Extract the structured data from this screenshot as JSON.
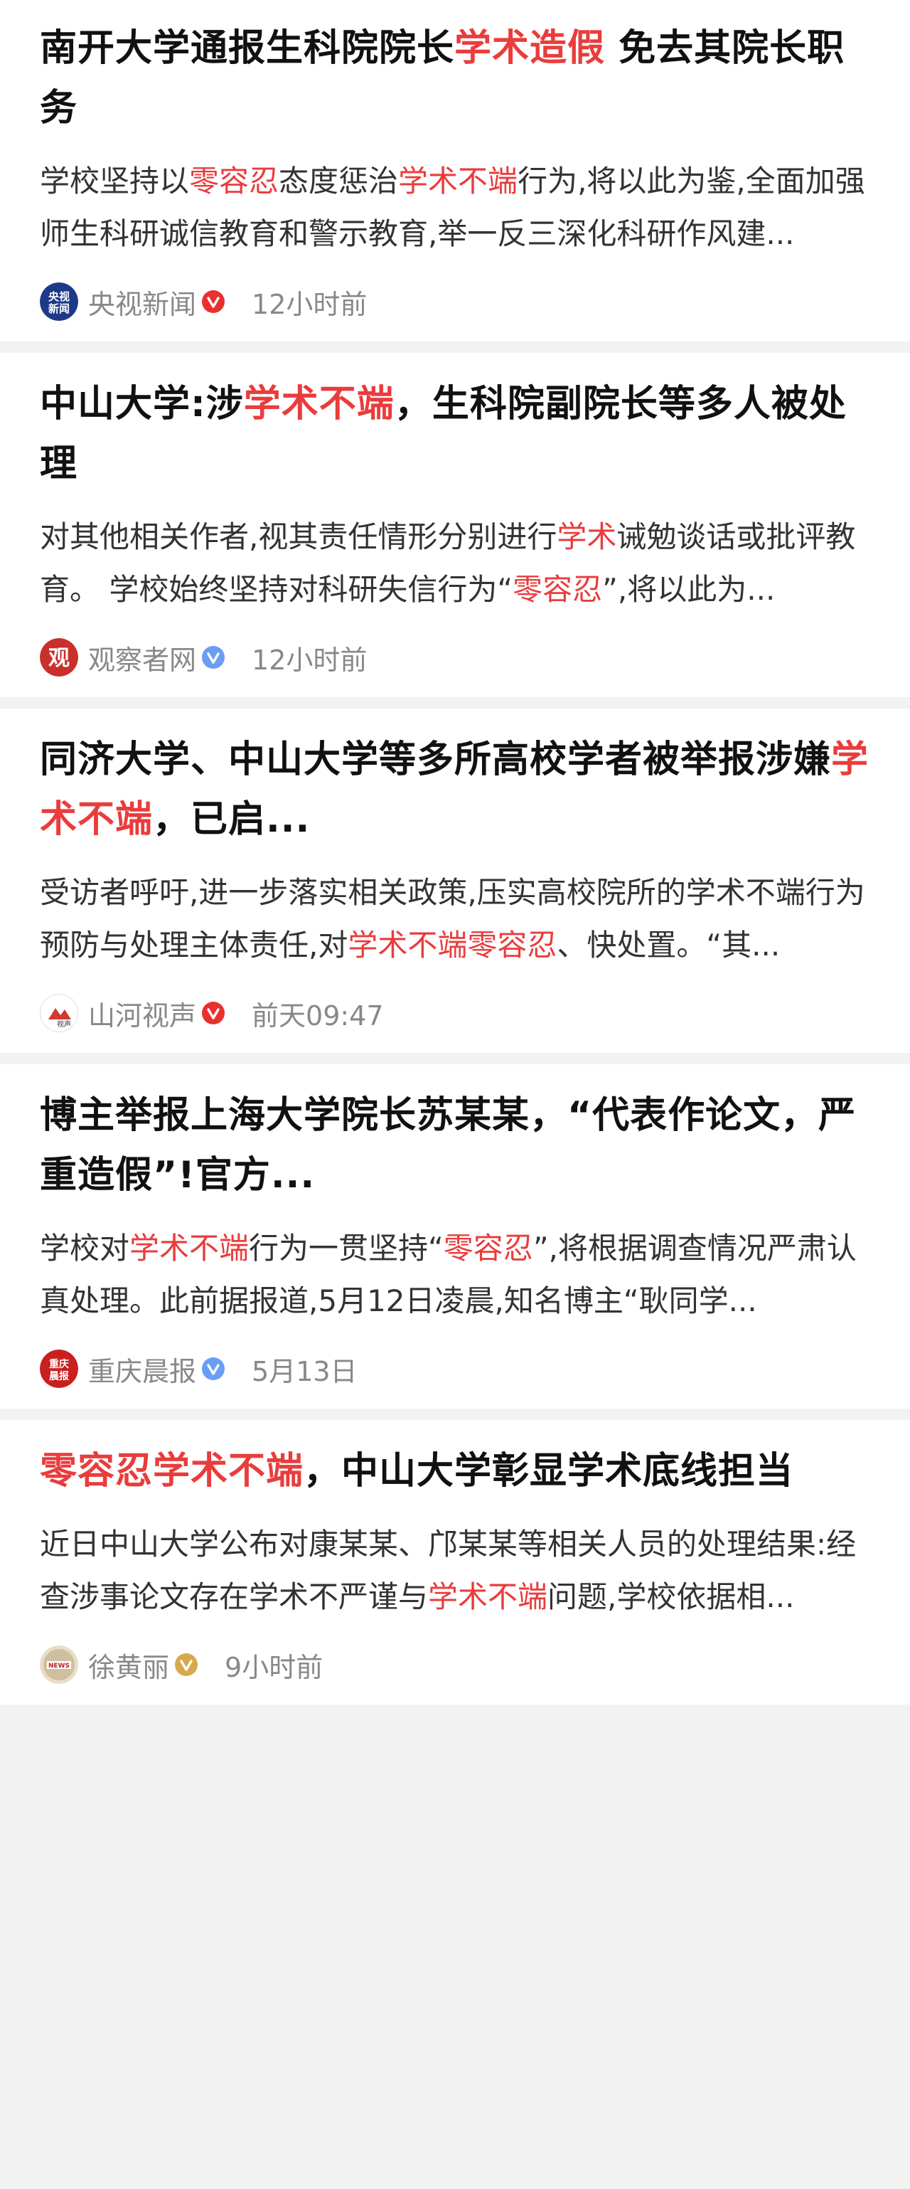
{
  "colors": {
    "highlight": "#ea3c3c",
    "verified_red": "#e8312f",
    "verified_blue": "#6a9ef5",
    "verified_gold": "#d9a84e"
  },
  "articles": [
    {
      "title": [
        {
          "text": "南开大学通报生科院院长",
          "hl": false
        },
        {
          "text": "学术造假",
          "hl": true
        },
        {
          "text": " 免去其院长职务",
          "hl": false
        }
      ],
      "summary": [
        {
          "text": "学校坚持以",
          "hl": false
        },
        {
          "text": "零容忍",
          "hl": true
        },
        {
          "text": "态度惩治",
          "hl": false
        },
        {
          "text": "学术不端",
          "hl": true
        },
        {
          "text": "行为,将以此为鉴,全面加强师生科研诚信教育和警示教育,举一反三深化科研作风建...",
          "hl": false
        }
      ],
      "source": "央视新闻",
      "avatar_icon": "cctv-news-logo-icon",
      "verified": "red",
      "time": "12小时前"
    },
    {
      "title": [
        {
          "text": "中山大学:涉",
          "hl": false
        },
        {
          "text": "学术不端",
          "hl": true
        },
        {
          "text": "，生科院副院长等多人被处理",
          "hl": false
        }
      ],
      "summary": [
        {
          "text": "对其他相关作者,视其责任情形分别进行",
          "hl": false
        },
        {
          "text": "学术",
          "hl": true
        },
        {
          "text": "诫勉谈话或批评教育。 学校始终坚持对科研失信行为“",
          "hl": false
        },
        {
          "text": "零容忍",
          "hl": true
        },
        {
          "text": "”,将以此为...",
          "hl": false
        }
      ],
      "source": "观察者网",
      "avatar_icon": "guancha-logo-icon",
      "verified": "blue",
      "time": "12小时前"
    },
    {
      "title": [
        {
          "text": "同济大学、中山大学等多所高校学者被举报涉嫌",
          "hl": false
        },
        {
          "text": "学术不端",
          "hl": true
        },
        {
          "text": "，已启...",
          "hl": false
        }
      ],
      "summary": [
        {
          "text": "受访者呼吁,进一步落实相关政策,压实高校院所的学术不端行为预防与处理主体责任,对",
          "hl": false
        },
        {
          "text": "学术不端零容忍",
          "hl": true
        },
        {
          "text": "、快处置。“其...",
          "hl": false
        }
      ],
      "source": "山河视声",
      "avatar_icon": "shanhe-logo-icon",
      "verified": "red",
      "time": "前天09:47"
    },
    {
      "title": [
        {
          "text": "博主举报上海大学院长苏某某，“代表作论文，严重造假”!官方...",
          "hl": false
        }
      ],
      "summary": [
        {
          "text": "学校对",
          "hl": false
        },
        {
          "text": "学术不端",
          "hl": true
        },
        {
          "text": "行为一贯坚持“",
          "hl": false
        },
        {
          "text": "零容忍",
          "hl": true
        },
        {
          "text": "”,将根据调查情况严肃认真处理。此前据报道,5月12日凌晨,知名博主“耿同学...",
          "hl": false
        }
      ],
      "source": "重庆晨报",
      "avatar_icon": "cq-morning-news-logo-icon",
      "verified": "blue",
      "time": "5月13日"
    },
    {
      "title": [
        {
          "text": "零容忍学术不端",
          "hl": true
        },
        {
          "text": "，中山大学彰显学术底线担当",
          "hl": false
        }
      ],
      "summary": [
        {
          "text": "近日中山大学公布对康某某、邝某某等相关人员的处理结果:经查涉事论文存在学术不严谨与",
          "hl": false
        },
        {
          "text": "学术不端",
          "hl": true
        },
        {
          "text": "问题,学校依据相...",
          "hl": false
        }
      ],
      "source": "徐黄丽",
      "avatar_icon": "user-avatar-icon",
      "verified": "gold",
      "time": "9小时前"
    }
  ]
}
